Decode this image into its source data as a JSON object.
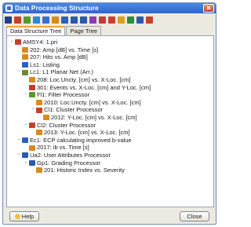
{
  "window": {
    "title": "Data Processing Structure",
    "close_glyph": "✕"
  },
  "toolbar": {
    "buttons": [
      {
        "icon": "save-icon",
        "color": "#1e3f8a"
      },
      {
        "icon": "load-icon",
        "color": "#c4432b"
      },
      {
        "icon": "filter-icon",
        "color": "#5a9a2e"
      },
      {
        "icon": "processor-icon",
        "color": "#2c8ad8"
      },
      {
        "icon": "grid-icon",
        "color": "#3a6fd0"
      },
      {
        "icon": "plot-icon",
        "color": "#d88a1e"
      },
      {
        "icon": "flag-icon",
        "color": "#2c62b8"
      },
      {
        "icon": "g-icon",
        "color": "#2b5aa8"
      },
      {
        "icon": "pi-icon",
        "color": "#2b5aa8"
      },
      {
        "icon": "chart-icon",
        "color": "#8a3bb0"
      },
      {
        "icon": "bars-icon",
        "color": "#c43a3a"
      },
      {
        "icon": "heart-icon",
        "color": "#c4432b"
      },
      {
        "icon": "star-icon",
        "color": "#d8a21e"
      },
      {
        "icon": "check-icon",
        "color": "#2e8a3e"
      },
      {
        "icon": "settings-icon",
        "color": "#2b5aa8"
      },
      {
        "icon": "marker-icon",
        "color": "#c4432b"
      }
    ]
  },
  "tabs": [
    {
      "label": "Data Structure Tree",
      "active": true
    },
    {
      "label": "Page Tree",
      "active": false
    }
  ],
  "tree": [
    {
      "text": "AMSY4: 1.pri",
      "depth": 0,
      "expander": "−",
      "icon": "root-icon",
      "color": "#c4432b"
    },
    {
      "text": "202: Amp [dB] vs. Time [s]",
      "depth": 1,
      "expander": "",
      "icon": "plot-icon",
      "color": "#d88a1e"
    },
    {
      "text": "207: Hits vs. Amp [dB]",
      "depth": 1,
      "expander": "",
      "icon": "plot-icon",
      "color": "#d88a1e"
    },
    {
      "text": "Ls1: Listing",
      "depth": 1,
      "expander": "",
      "icon": "listing-icon",
      "color": "#2c62b8"
    },
    {
      "text": "Lc1: L1 Planar Net (Arr.)",
      "depth": 1,
      "expander": "−",
      "icon": "locator-icon",
      "color": "#6d8a2e"
    },
    {
      "text": "208: Loc.Uncty. [cm] vs. X-Loc. [cm]",
      "depth": 2,
      "expander": "",
      "icon": "plot-icon",
      "color": "#d88a1e"
    },
    {
      "text": "301: Events vs. X-Loc. [cm] and Y-Loc. [cm]",
      "depth": 2,
      "expander": "",
      "icon": "plot-3d-icon",
      "color": "#c43a3a"
    },
    {
      "text": "Fl1: Filter Processor",
      "depth": 2,
      "expander": "−",
      "icon": "filter-icon",
      "color": "#5a9a2e"
    },
    {
      "text": "2010: Loc.Uncty. [cm] vs. X-Loc. [cm]",
      "depth": 3,
      "expander": "",
      "icon": "plot-icon",
      "color": "#d88a1e"
    },
    {
      "text": "Cl1: Cluster Processor",
      "depth": 3,
      "expander": "−",
      "icon": "cluster-icon",
      "color": "#c4432b"
    },
    {
      "text": "2012: Y-Loc. [cm] vs. X-Loc. [cm]",
      "depth": 4,
      "expander": "",
      "icon": "plot-icon",
      "color": "#d88a1e"
    },
    {
      "text": "Cl2: Cluster Processor",
      "depth": 2,
      "expander": "−",
      "icon": "cluster-icon",
      "color": "#c4432b"
    },
    {
      "text": "2013: Y-Loc. [cm] vs. X-Loc. [cm]",
      "depth": 3,
      "expander": "",
      "icon": "plot-icon",
      "color": "#d88a1e"
    },
    {
      "text": "Ec1: ECP calculating improved b-value",
      "depth": 1,
      "expander": "−",
      "icon": "ecp-icon",
      "color": "#2c62b8"
    },
    {
      "text": "2017: ib vs. Time [s]",
      "depth": 2,
      "expander": "",
      "icon": "plot-icon",
      "color": "#d88a1e"
    },
    {
      "text": "Ua2: User Attributes Processor",
      "depth": 1,
      "expander": "−",
      "icon": "pi-icon",
      "color": "#2b5aa8"
    },
    {
      "text": "Gp1: Grading Processor",
      "depth": 2,
      "expander": "−",
      "icon": "g-icon",
      "color": "#2b5aa8"
    },
    {
      "text": "201: Historic Index vs. Severity",
      "depth": 3,
      "expander": "",
      "icon": "plot-icon",
      "color": "#d88a1e"
    }
  ],
  "buttons": {
    "help": "Help",
    "close": "Close"
  }
}
